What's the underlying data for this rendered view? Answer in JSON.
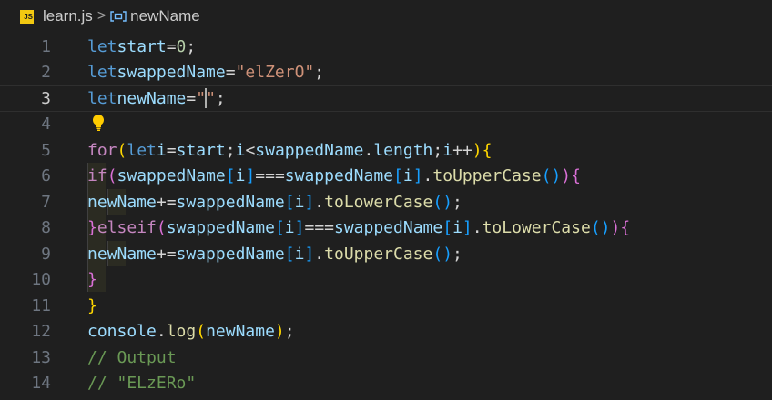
{
  "breadcrumb": {
    "file_icon": "js-file-icon",
    "file_icon_label": "JS",
    "file_name": "learn.js",
    "separator": ">",
    "symbol_icon": "variable-icon",
    "symbol_name": "newName"
  },
  "editor": {
    "current_line": 3,
    "lightbulb_line": 4,
    "lines": [
      {
        "number": "1",
        "text": "let start = 0;"
      },
      {
        "number": "2",
        "text": "let swappedName = \"elZerO\";"
      },
      {
        "number": "3",
        "text": "let newName = \"\";"
      },
      {
        "number": "4",
        "text": ""
      },
      {
        "number": "5",
        "text": "for (let i = start; i < swappedName.length; i++) {"
      },
      {
        "number": "6",
        "text": "  if (swappedName[i] === swappedName[i].toUpperCase()) {"
      },
      {
        "number": "7",
        "text": "    newName += swappedName[i].toLowerCase();"
      },
      {
        "number": "8",
        "text": "  } else if (swappedName[i] === swappedName[i].toLowerCase()) {"
      },
      {
        "number": "9",
        "text": "    newName += swappedName[i].toUpperCase();"
      },
      {
        "number": "10",
        "text": "  }"
      },
      {
        "number": "11",
        "text": "}"
      },
      {
        "number": "12",
        "text": "console.log(newName);"
      },
      {
        "number": "13",
        "text": "// Output"
      },
      {
        "number": "14",
        "text": "// \"ELzERo\""
      }
    ]
  },
  "colors": {
    "background": "#1f1f1f",
    "keyword": "#569cd6",
    "control": "#c586c0",
    "variable": "#9cdcfe",
    "function": "#dcdcaa",
    "string": "#ce9178",
    "number": "#b5cea8",
    "comment": "#6a9955",
    "js_badge": "#f2c811"
  }
}
